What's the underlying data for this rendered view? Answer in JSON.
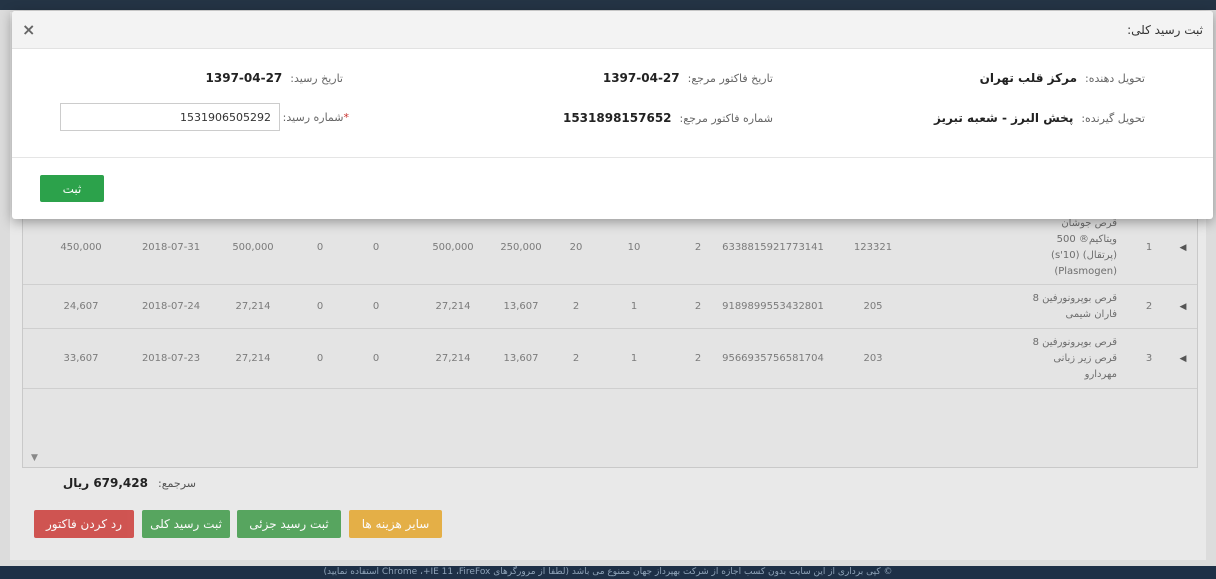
{
  "modal": {
    "title": "ثبت رسید کلی:",
    "close_icon": "×",
    "delivered_by_label": "تحویل دهنده:",
    "delivered_by_value": "مرکز قلب تهران",
    "ref_invoice_date_label": "تاریخ فاکتور مرجع:",
    "ref_invoice_date_value": "1397-04-27",
    "receipt_date_label": "تاریخ رسید:",
    "receipt_date_value": "1397-04-27",
    "receiver_label": "تحویل گیرنده:",
    "receiver_value": "پخش البرز - شعبه تبریز",
    "ref_invoice_number_label": "شماره فاکتور مرجع:",
    "ref_invoice_number_value": "1531898157652",
    "receipt_number_label": "شماره رسید:",
    "receipt_number_required": "*",
    "receipt_number_value": "1531906505292",
    "submit_label": "ثبت"
  },
  "grid": {
    "rows": [
      {
        "row": "1",
        "name": "قرص جوشان ویتاکیم® 500 (پرتقال) (10's) (Plasmogen)",
        "code": "123321",
        "barcode": "6338815921773141",
        "c1": "2",
        "c2": "10",
        "c3": "20",
        "unit_price": "250,000",
        "total": "500,000",
        "c4": "0",
        "c5": "0",
        "final": "500,000",
        "date": "2018-07-31",
        "payable": "450,000"
      },
      {
        "row": "2",
        "name": "قرص بوپرونورفین 8 فاران شیمی",
        "code": "205",
        "barcode": "9189899553432801",
        "c1": "2",
        "c2": "1",
        "c3": "2",
        "unit_price": "13,607",
        "total": "27,214",
        "c4": "0",
        "c5": "0",
        "final": "27,214",
        "date": "2018-07-24",
        "payable": "24,607"
      },
      {
        "row": "3",
        "name": "قرص بوپرونورفین 8 قرص زیر زبانی مهردارو",
        "code": "203",
        "barcode": "9566935756581704",
        "c1": "2",
        "c2": "1",
        "c3": "2",
        "unit_price": "13,607",
        "total": "27,214",
        "c4": "0",
        "c5": "0",
        "final": "27,214",
        "date": "2018-07-23",
        "payable": "33,607"
      }
    ]
  },
  "summary": {
    "label": "سرجمع:",
    "value": "679,428 ریال"
  },
  "actions": {
    "other_costs": "سایر هزینه ها",
    "partial_receipt": "ثبت رسید جزئی",
    "total_receipt": "ثبت رسید کلی",
    "reject_invoice": "رد کردن فاکتور"
  },
  "footer": {
    "text": "© کپی برداری از این سایت بدون کسب اجازه از شرکت بهپرداز جهان ممنوع می باشد (لطفا از مرورگرهای Chrome ،+IE 11 ،FireFox استفاده نمایید)"
  }
}
